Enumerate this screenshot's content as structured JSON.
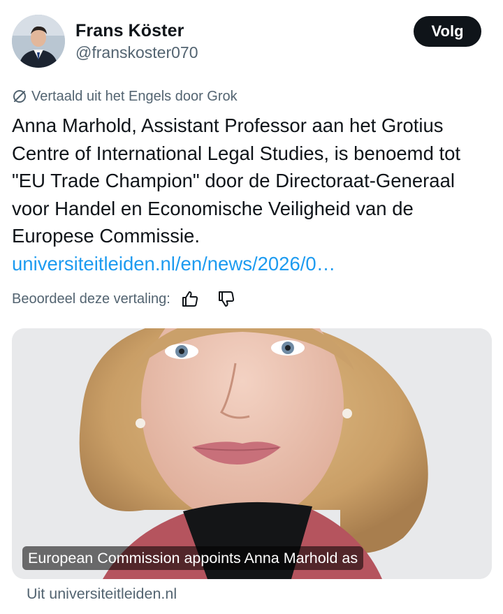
{
  "author": {
    "name": "Frans Köster",
    "handle": "@franskoster070",
    "avatar_icon": "profile-photo"
  },
  "follow_label": "Volg",
  "translation": {
    "notice": "Vertaald uit het Engels door Grok",
    "notice_icon": "translate-slash-icon",
    "rate_label": "Beoordeel deze vertaling:",
    "thumbs_up_icon": "thumbs-up-icon",
    "thumbs_down_icon": "thumbs-down-icon"
  },
  "post": {
    "text": "Anna Marhold, Assistant Professor aan het Grotius Centre of International Legal Studies, is benoemd tot \"EU Trade Champion\" door de Directoraat-Generaal voor Handel en Economische Veiligheid van de Europese Commissie. ",
    "link_text": "universiteitleiden.nl/en/news/2026/0…"
  },
  "card": {
    "caption": "European Commission appoints Anna Marhold as",
    "source": "Uit universiteitleiden.nl"
  },
  "colors": {
    "link": "#1d9bf0",
    "secondary_text": "#536471",
    "primary_text": "#0f1419",
    "button_bg": "#0f1419"
  }
}
